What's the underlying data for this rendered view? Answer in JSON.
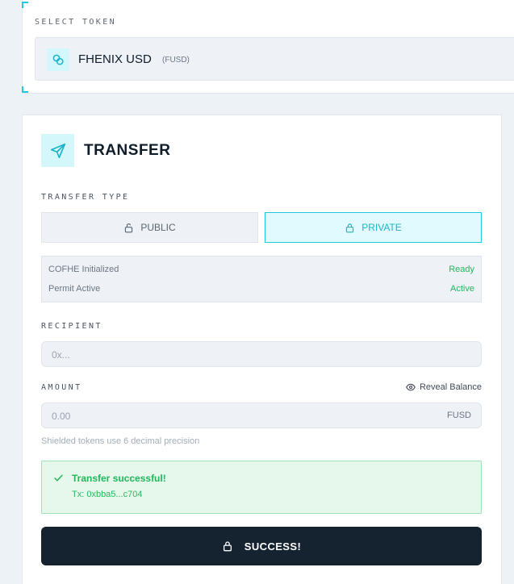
{
  "token_select": {
    "label": "SELECT TOKEN",
    "token_name": "FHENIX USD",
    "token_symbol": "(FUSD)",
    "icon": "coins-icon"
  },
  "transfer": {
    "title": "TRANSFER",
    "icon": "send-icon",
    "type_label": "TRANSFER TYPE",
    "types": [
      {
        "label": "PUBLIC",
        "icon": "unlock-icon",
        "selected": false
      },
      {
        "label": "PRIVATE",
        "icon": "lock-icon",
        "selected": true
      }
    ],
    "status": [
      {
        "key": "COFHE Initialized",
        "value": "Ready"
      },
      {
        "key": "Permit Active",
        "value": "Active"
      }
    ],
    "recipient": {
      "label": "RECIPIENT",
      "placeholder": "0x..."
    },
    "amount": {
      "label": "AMOUNT",
      "placeholder": "0.00",
      "unit": "FUSD",
      "reveal_label": "Reveal Balance",
      "hint": "Shielded tokens use 6 decimal precision"
    },
    "success": {
      "title": "Transfer successful!",
      "tx": "Tx: 0xbba5...c704"
    },
    "submit_label": "SUCCESS!"
  },
  "colors": {
    "accent": "#22c8e0",
    "success": "#20b85a",
    "button_dark": "#152230"
  }
}
